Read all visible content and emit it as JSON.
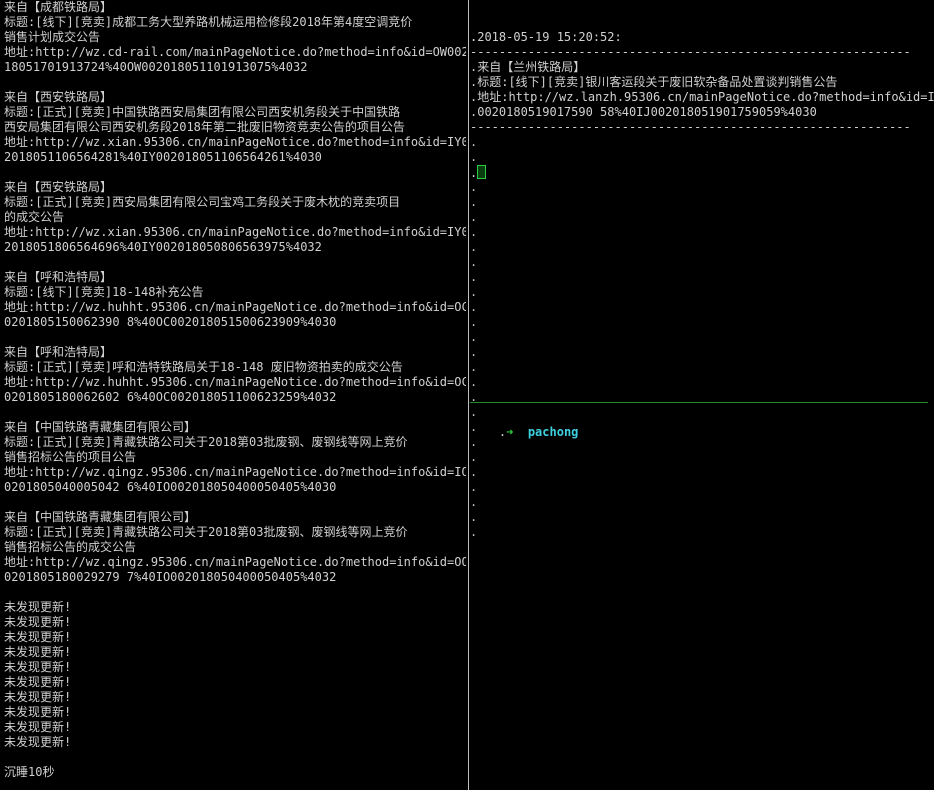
{
  "left_pane": {
    "lines": [
      "来自【成都铁路局】",
      "标题:[线下][竞卖]成都工务大型养路机械运用检修段2018年第4度空调竞价",
      "销售计划成交公告",
      "地址:http://wz.cd-rail.com/mainPageNotice.do?method=info&id=OW0020",
      "18051701913724%40OW002018051101913075%4032",
      "",
      "来自【西安铁路局】",
      "标题:[正式][竞卖]中国铁路西安局集团有限公司西安机务段关于中国铁路",
      "西安局集团有限公司西安机务段2018年第二批废旧物资竞卖公告的项目公告",
      "地址:http://wz.xian.95306.cn/mainPageNotice.do?method=info&id=IY00",
      "2018051106564281%40IY002018051106564261%4030",
      "",
      "来自【西安铁路局】",
      "标题:[正式][竞卖]西安局集团有限公司宝鸡工务段关于废木枕的竞卖项目",
      "的成交公告",
      "地址:http://wz.xian.95306.cn/mainPageNotice.do?method=info&id=IY00",
      "2018051806564696%40IY002018050806563975%4032",
      "",
      "来自【呼和浩特局】",
      "标题:[线下][竞卖]18-148补充公告",
      "地址:http://wz.huhht.95306.cn/mainPageNotice.do?method=info&id=OC0",
      "0201805150062390 8%40OC002018051500623909%4030",
      "",
      "来自【呼和浩特局】",
      "标题:[正式][竞卖]呼和浩特铁路局关于18-148 废旧物资拍卖的成交公告",
      "地址:http://wz.huhht.95306.cn/mainPageNotice.do?method=info&id=OC0",
      "0201805180062602 6%40OC002018051100623259%4032",
      "",
      "来自【中国铁路青藏集团有限公司】",
      "标题:[正式][竞卖]青藏铁路公司关于2018第03批废钢、废钢线等网上竞价",
      "销售招标公告的项目公告",
      "地址:http://wz.qingz.95306.cn/mainPageNotice.do?method=info&id=IO0",
      "0201805040005042 6%40IO002018050400050405%4030",
      "",
      "来自【中国铁路青藏集团有限公司】",
      "标题:[正式][竞卖]青藏铁路公司关于2018第03批废钢、废钢线等网上竞价",
      "销售招标公告的成交公告",
      "地址:http://wz.qingz.95306.cn/mainPageNotice.do?method=info&id=OO0",
      "0201805180029279 7%40IO002018050400050405%4032",
      "",
      "未发现更新!",
      "未发现更新!",
      "未发现更新!",
      "未发现更新!",
      "未发现更新!",
      "未发现更新!",
      "未发现更新!",
      "未发现更新!",
      "未发现更新!",
      "未发现更新!",
      "",
      "沉睡10秒"
    ]
  },
  "right_pane": {
    "timestamp": "2018-05-19 15:20:52:",
    "separator": "-------------------------------------------------------------",
    "source": "来自【兰州铁路局】",
    "title": "标题:[线下][竞卖]银川客运段关于废旧软杂备品处置谈判销售公告",
    "address_1": "地址:http://wz.lanzh.95306.cn/mainPageNotice.do?method=info&id=IJ",
    "address_2": "0020180519017590 58%40IJ002018051901759059%4030",
    "prompt_arrow": "➜",
    "prompt_dir": "pachong"
  }
}
